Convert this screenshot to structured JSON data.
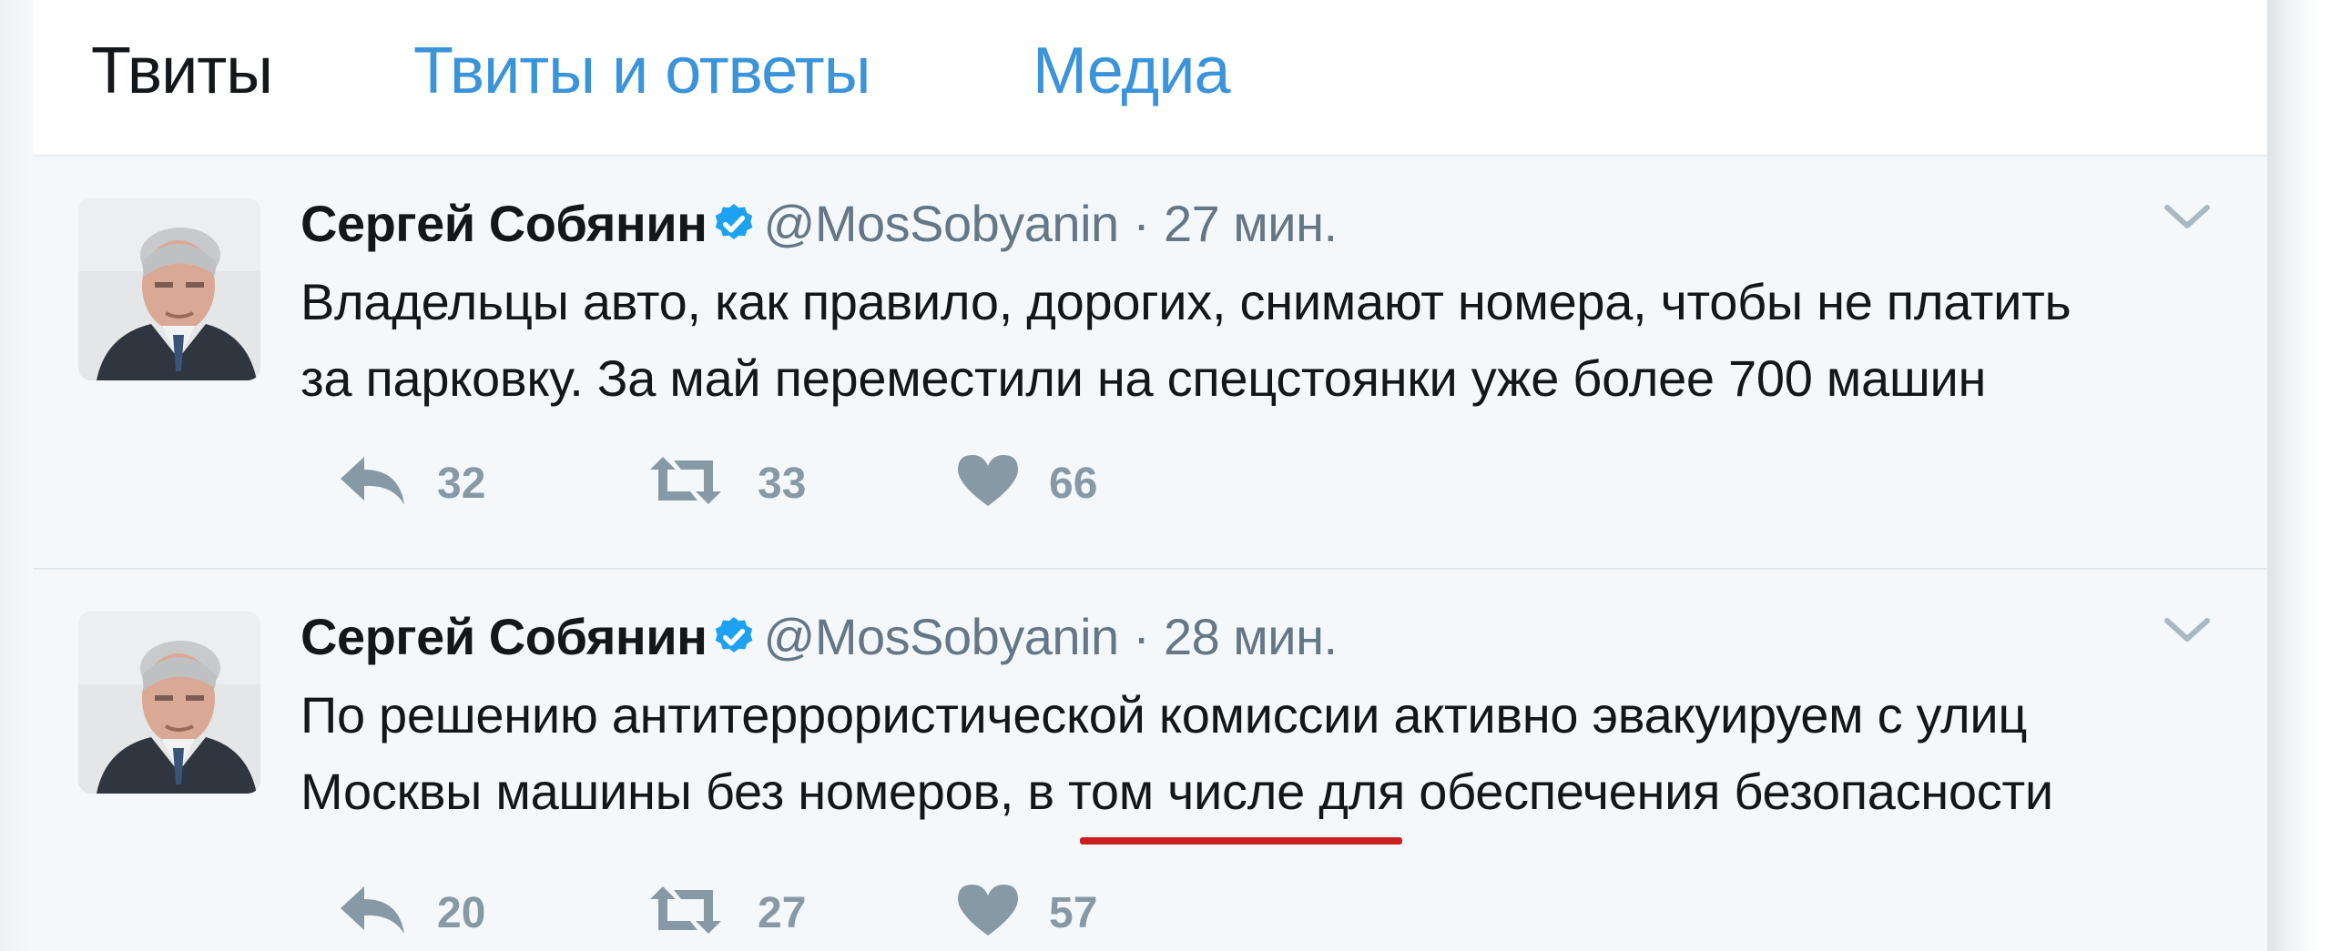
{
  "tabs": {
    "tweets": "Твиты",
    "tweets_and_replies": "Твиты и ответы",
    "media": "Медиа"
  },
  "tweets": [
    {
      "author_name": "Сергей Собянин",
      "handle": "@MosSobyanin",
      "separator": "·",
      "time": "27 мин.",
      "text_lines": [
        "Владельцы авто, как правило, дорогих, снимают номера, чтобы не платить",
        "за парковку. За май переместили на спецстоянки уже более 700 машин"
      ],
      "replies": "32",
      "retweets": "33",
      "likes": "66"
    },
    {
      "author_name": "Сергей Собянин",
      "handle": "@MosSobyanin",
      "separator": "·",
      "time": "28 мин.",
      "text_lines": [
        "По решению антитеррористической комиссии активно эвакуируем с улиц",
        "Москвы машины без номеров, в том числе для обеспечения безопасности"
      ],
      "replies": "20",
      "retweets": "27",
      "likes": "57"
    }
  ],
  "colors": {
    "link_blue": "#3b94d9",
    "verified_blue": "#1da1f2",
    "muted_gray": "#657786",
    "action_gray": "#8899a6",
    "tweet_bg": "#f5f8fa",
    "highlight_red": "#cc1f22"
  },
  "icons": [
    "verified-badge-icon",
    "chevron-down-icon",
    "reply-icon",
    "retweet-icon",
    "heart-icon",
    "avatar"
  ]
}
